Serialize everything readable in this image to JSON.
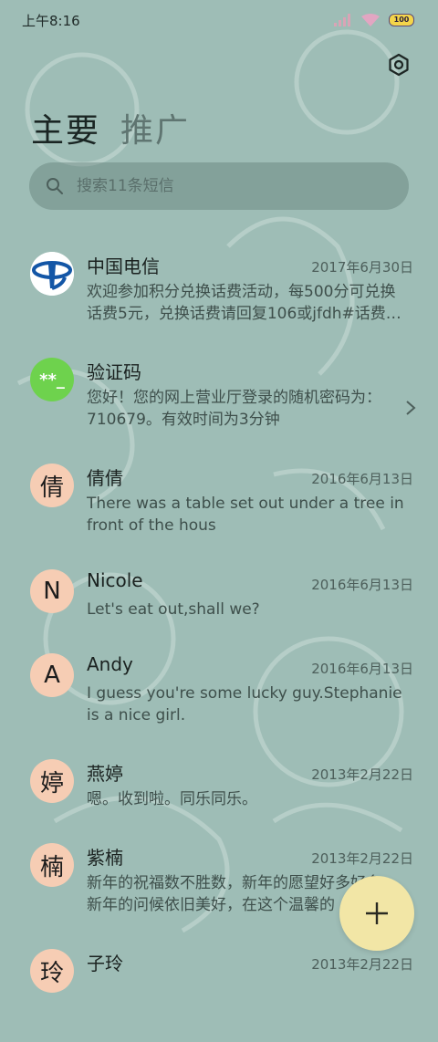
{
  "status_bar": {
    "time": "上午8:16",
    "battery": "100"
  },
  "tabs": [
    {
      "label": "主要"
    },
    {
      "label": "推广"
    }
  ],
  "search": {
    "placeholder": "搜索11条短信"
  },
  "conversations": [
    {
      "name": "中国电信",
      "date": "2017年6月30日",
      "preview": "欢迎参加积分兑换话费活动，每500分可兑换话费5元，兑换话费请回复106或jfdh#话费…",
      "avatar_type": "logo"
    },
    {
      "name": "验证码",
      "date": "",
      "preview": "您好！您的网上营业厅登录的随机密码为：710679。有效时间为3分钟",
      "avatar_type": "code",
      "avatar_text": "**_"
    },
    {
      "name": "倩倩",
      "date": "2016年6月13日",
      "preview": "There was a table set out under a tree in front of the hous",
      "avatar_text": "倩"
    },
    {
      "name": "Nicole",
      "date": "2016年6月13日",
      "preview": "Let's eat out,shall we?",
      "avatar_text": "N"
    },
    {
      "name": "Andy",
      "date": "2016年6月13日",
      "preview": "I guess you're some lucky guy.Stephanie is a nice girl.",
      "avatar_text": "A"
    },
    {
      "name": "燕婷",
      "date": "2013年2月22日",
      "preview": "嗯。收到啦。同乐同乐。",
      "avatar_text": "婷"
    },
    {
      "name": "紫楠",
      "date": "2013年2月22日",
      "preview": "新年的祝福数不胜数，新年的愿望好多好多，新年的问候依旧美好，在这个温馨的",
      "avatar_text": "楠"
    },
    {
      "name": "子玲",
      "date": "2013年2月22日",
      "preview": "",
      "avatar_text": "玲"
    }
  ],
  "colors": {
    "background": "#9ebdb6",
    "fab": "#f2e6a6",
    "avatar_letter": "#f6cdb4",
    "code_avatar": "#6ed24d",
    "telecom_blue": "#1356a6"
  },
  "icons": {
    "settings": "settings-icon",
    "search": "search-icon",
    "new_message": "plus-icon",
    "chevron": "chevron-right-icon"
  }
}
